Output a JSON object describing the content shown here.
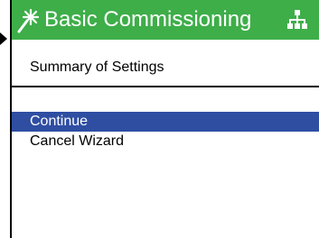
{
  "window": {
    "title": "Basic Commissioning",
    "title_icon": "magic-wand-icon",
    "status_icon": "network-icon"
  },
  "page": {
    "subtitle": "Summary of Settings"
  },
  "menu": {
    "items": [
      {
        "label": "Continue",
        "selected": true
      },
      {
        "label": "Cancel Wizard",
        "selected": false
      }
    ]
  },
  "colors": {
    "titlebar": "#3eae49",
    "selection": "#2f4ea2",
    "text": "#000000",
    "background": "#ffffff"
  }
}
